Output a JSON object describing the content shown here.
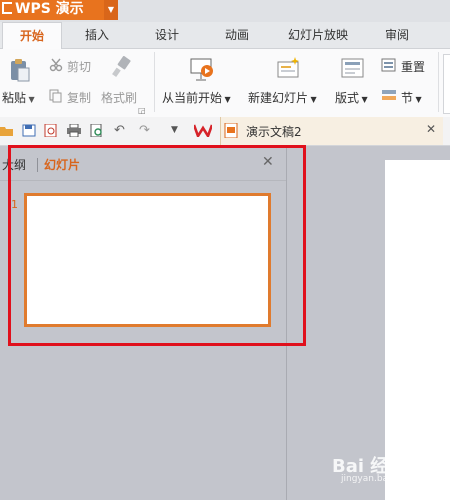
{
  "app": {
    "title": "WPS 演示",
    "accent": "#e8731e"
  },
  "tabs": [
    "开始",
    "插入",
    "设计",
    "动画",
    "幻灯片放映",
    "审阅"
  ],
  "ribbon": {
    "paste": "粘贴",
    "cut": "剪切",
    "copy": "复制",
    "format_painter": "格式刷",
    "from_current": "从当前开始",
    "new_slide": "新建幻灯片",
    "layout": "版式",
    "reset": "重置",
    "section": "节"
  },
  "document": {
    "tab_name": "演示文稿2"
  },
  "pane": {
    "outline_tab": "大纲",
    "slides_tab": "幻灯片",
    "slide_number": "1"
  },
  "watermark": {
    "main": "Bai 经验",
    "sub": "jingyan.baidu.com"
  },
  "colors": {
    "highlight_box": "#e0101c",
    "thumb_border": "#e07b2e"
  }
}
